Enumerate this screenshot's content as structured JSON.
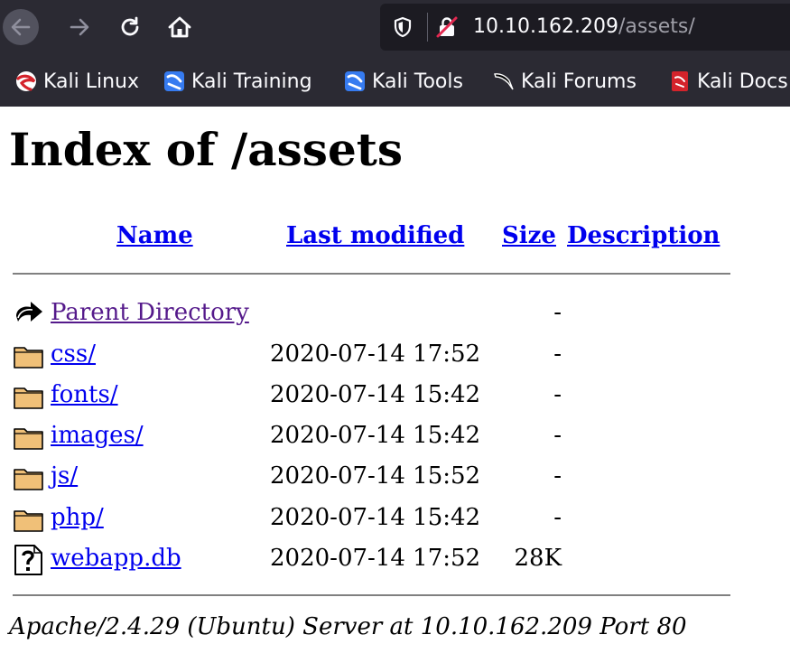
{
  "browser": {
    "url_host": "10.10.162.209",
    "url_path": "/assets/",
    "bookmarks": [
      {
        "label": "Kali Linux",
        "icon": "kali-linux-icon"
      },
      {
        "label": "Kali Training",
        "icon": "kali-training-icon"
      },
      {
        "label": "Kali Tools",
        "icon": "kali-tools-icon"
      },
      {
        "label": "Kali Forums",
        "icon": "kali-forums-icon"
      },
      {
        "label": "Kali Docs",
        "icon": "kali-docs-icon"
      }
    ],
    "icons": [
      "back-arrow-icon",
      "forward-arrow-icon",
      "reload-icon",
      "home-icon",
      "shield-icon",
      "insecure-lock-icon"
    ],
    "colors": {
      "chrome_bg": "#2b2a33",
      "urlbar_bg": "#1c1b22",
      "link": "#0000ee",
      "visited": "#551a8b"
    }
  },
  "page": {
    "title": "Index of /assets",
    "columns": {
      "name": "Name",
      "last_modified": "Last modified",
      "size": "Size",
      "description": "Description"
    },
    "rows": [
      {
        "name": "Parent Directory",
        "date": "",
        "size": "-",
        "icon": "parent-directory-icon"
      },
      {
        "name": "css/",
        "date": "2020-07-14 17:52",
        "size": "-",
        "icon": "folder-icon"
      },
      {
        "name": "fonts/",
        "date": "2020-07-14 15:42",
        "size": "-",
        "icon": "folder-icon"
      },
      {
        "name": "images/",
        "date": "2020-07-14 15:42",
        "size": "-",
        "icon": "folder-icon"
      },
      {
        "name": "js/",
        "date": "2020-07-14 15:52",
        "size": "-",
        "icon": "folder-icon"
      },
      {
        "name": "php/",
        "date": "2020-07-14 15:42",
        "size": "-",
        "icon": "folder-icon"
      },
      {
        "name": "webapp.db",
        "date": "2020-07-14 17:52",
        "size": "28K",
        "icon": "unknown-file-icon"
      }
    ],
    "footer": "Apache/2.4.29 (Ubuntu) Server at 10.10.162.209 Port 80"
  }
}
